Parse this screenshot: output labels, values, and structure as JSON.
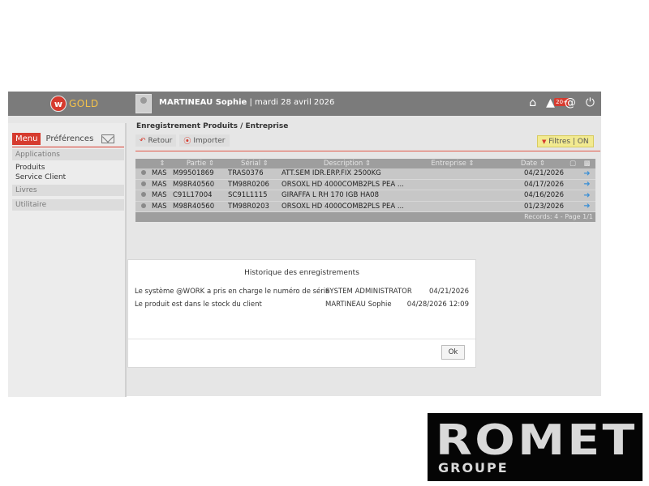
{
  "colors": {
    "accent": "#d63b2f",
    "topbar": "#7b7b7b",
    "filter_bg": "#f2ea90",
    "arrow": "#3a8fd6"
  },
  "app": {
    "logo_letter": "w",
    "logo_text": "GOLD"
  },
  "header": {
    "user_name": "MARTINEAU Sophie",
    "date_text": "| mardi 28 avril 2026",
    "icons": [
      "home-icon",
      "notifications-icon",
      "at-icon",
      "power-icon"
    ],
    "notif_badge": "20+"
  },
  "sidebar": {
    "tab_menu": "Menu",
    "tab_prefs": "Préférences",
    "sections": [
      {
        "label": "Applications",
        "items": [
          "Produits",
          "Service Client"
        ]
      },
      {
        "label": "Livres",
        "items": []
      },
      {
        "label": "Utilitaire",
        "items": []
      }
    ]
  },
  "page": {
    "title": "Enregistrement Produits / Entreprise",
    "back_label": "Retour",
    "import_label": "Importer",
    "filters_label": "Filtres | ON"
  },
  "grid": {
    "columns": [
      "",
      "Partie",
      "Sérial",
      "Description",
      "Entreprise",
      "Date"
    ],
    "rows": [
      {
        "company": "MAS",
        "part": "M99501869",
        "serial": "TRAS0376",
        "description": "ATT.SEM IDR.ERP.FIX 2500KG",
        "enterprise": "",
        "date": "04/21/2026"
      },
      {
        "company": "MAS",
        "part": "M98R40560",
        "serial": "TM98R0206",
        "description": "ORSOXL HD 4000COMB2PLS PEA ...",
        "enterprise": "",
        "date": "04/17/2026"
      },
      {
        "company": "MAS",
        "part": "C91L17004",
        "serial": "SC91L1115",
        "description": "GIRAFFA L RH 170 IGB HA08",
        "enterprise": "",
        "date": "04/16/2026"
      },
      {
        "company": "MAS",
        "part": "M98R40560",
        "serial": "TM98R0203",
        "description": "ORSOXL HD 4000COMB2PLS PEA ...",
        "enterprise": "",
        "date": "01/23/2026"
      }
    ],
    "footer": "Records: 4 - Page 1/1"
  },
  "modal": {
    "title": "Historique des enregistrements",
    "entries": [
      {
        "text": "Le système @WORK a pris en charge le numéro de série",
        "who": "SYSTEM ADMINISTRATOR",
        "date": "04/21/2026"
      },
      {
        "text": "Le produit est dans le stock du client",
        "who": "MARTINEAU Sophie",
        "date": "04/28/2026 12:09"
      }
    ],
    "ok_label": "Ok"
  },
  "brand": {
    "name": "ROMET",
    "sub": "GROUPE"
  }
}
